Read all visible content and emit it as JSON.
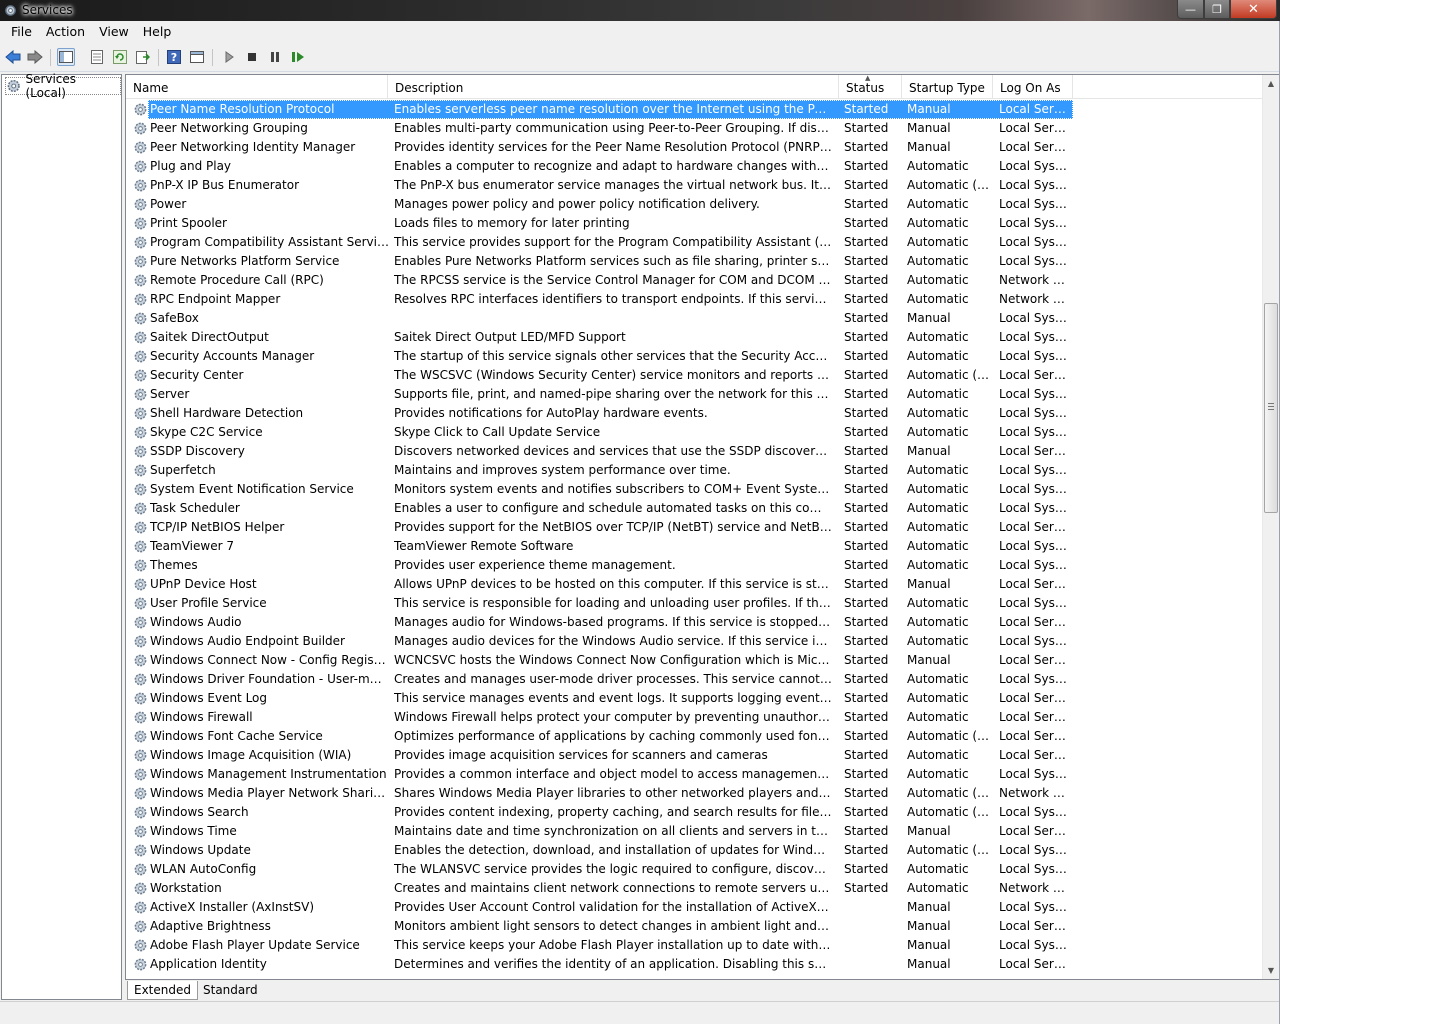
{
  "window": {
    "title": "Services",
    "minimize": "—",
    "maximize": "❐",
    "close": "✕"
  },
  "menu": [
    "File",
    "Action",
    "View",
    "Help"
  ],
  "tree": {
    "root": "Services (Local)"
  },
  "columns": {
    "name": "Name",
    "description": "Description",
    "status": "Status",
    "startup": "Startup Type",
    "logon": "Log On As"
  },
  "services": [
    {
      "name": "Peer Name Resolution Protocol",
      "desc": "Enables serverless peer name resolution over the Internet using the Peer Name Re...",
      "status": "Started",
      "startup": "Manual",
      "logon": "Local Service"
    },
    {
      "name": "Peer Networking Grouping",
      "desc": "Enables multi-party communication using Peer-to-Peer Grouping.  If disabled, so...",
      "status": "Started",
      "startup": "Manual",
      "logon": "Local Service"
    },
    {
      "name": "Peer Networking Identity Manager",
      "desc": "Provides identity services for the Peer Name Resolution Protocol (PNRP) and Peer...",
      "status": "Started",
      "startup": "Manual",
      "logon": "Local Service"
    },
    {
      "name": "Plug and Play",
      "desc": "Enables a computer to recognize and adapt to hardware changes with little or no ...",
      "status": "Started",
      "startup": "Automatic",
      "logon": "Local Syste..."
    },
    {
      "name": "PnP-X IP Bus Enumerator",
      "desc": "The PnP-X bus enumerator service manages the virtual network bus. It discovers ...",
      "status": "Started",
      "startup": "Automatic (D...",
      "logon": "Local Syste..."
    },
    {
      "name": "Power",
      "desc": "Manages power policy and power policy notification delivery.",
      "status": "Started",
      "startup": "Automatic",
      "logon": "Local Syste..."
    },
    {
      "name": "Print Spooler",
      "desc": "Loads files to memory for later printing",
      "status": "Started",
      "startup": "Automatic",
      "logon": "Local Syste..."
    },
    {
      "name": "Program Compatibility Assistant Service",
      "desc": "This service provides support for the Program Compatibility Assistant (PCA).  PC...",
      "status": "Started",
      "startup": "Automatic",
      "logon": "Local Syste..."
    },
    {
      "name": "Pure Networks Platform Service",
      "desc": "Enables Pure Networks Platform services such as file sharing, printer sharing, and ...",
      "status": "Started",
      "startup": "Automatic",
      "logon": "Local Syste..."
    },
    {
      "name": "Remote Procedure Call (RPC)",
      "desc": "The RPCSS service is the Service Control Manager for COM and DCOM servers. It ...",
      "status": "Started",
      "startup": "Automatic",
      "logon": "Network S..."
    },
    {
      "name": "RPC Endpoint Mapper",
      "desc": "Resolves RPC interfaces identifiers to transport endpoints. If this service is stoppe...",
      "status": "Started",
      "startup": "Automatic",
      "logon": "Network S..."
    },
    {
      "name": "SafeBox",
      "desc": "",
      "status": "Started",
      "startup": "Manual",
      "logon": "Local Syste..."
    },
    {
      "name": "Saitek DirectOutput",
      "desc": "Saitek Direct Output LED/MFD Support",
      "status": "Started",
      "startup": "Automatic",
      "logon": "Local Syste..."
    },
    {
      "name": "Security Accounts Manager",
      "desc": "The startup of this service signals other services that the Security Accounts Mana...",
      "status": "Started",
      "startup": "Automatic",
      "logon": "Local Syste..."
    },
    {
      "name": "Security Center",
      "desc": "The WSCSVC (Windows Security Center) service monitors and reports security he...",
      "status": "Started",
      "startup": "Automatic (D...",
      "logon": "Local Service"
    },
    {
      "name": "Server",
      "desc": "Supports file, print, and named-pipe sharing over the network for this computer. I...",
      "status": "Started",
      "startup": "Automatic",
      "logon": "Local Syste..."
    },
    {
      "name": "Shell Hardware Detection",
      "desc": "Provides notifications for AutoPlay hardware events.",
      "status": "Started",
      "startup": "Automatic",
      "logon": "Local Syste..."
    },
    {
      "name": "Skype C2C Service",
      "desc": "Skype Click to Call Update Service",
      "status": "Started",
      "startup": "Automatic",
      "logon": "Local Syste..."
    },
    {
      "name": "SSDP Discovery",
      "desc": "Discovers networked devices and services that use the SSDP discovery protocol, s...",
      "status": "Started",
      "startup": "Manual",
      "logon": "Local Service"
    },
    {
      "name": "Superfetch",
      "desc": "Maintains and improves system performance over time.",
      "status": "Started",
      "startup": "Automatic",
      "logon": "Local Syste..."
    },
    {
      "name": "System Event Notification Service",
      "desc": "Monitors system events and notifies subscribers to COM+ Event System of these ...",
      "status": "Started",
      "startup": "Automatic",
      "logon": "Local Syste..."
    },
    {
      "name": "Task Scheduler",
      "desc": "Enables a user to configure and schedule automated tasks on this computer. The ...",
      "status": "Started",
      "startup": "Automatic",
      "logon": "Local Syste..."
    },
    {
      "name": "TCP/IP NetBIOS Helper",
      "desc": "Provides support for the NetBIOS over TCP/IP (NetBT) service and NetBIOS name ...",
      "status": "Started",
      "startup": "Automatic",
      "logon": "Local Service"
    },
    {
      "name": "TeamViewer 7",
      "desc": "TeamViewer Remote Software",
      "status": "Started",
      "startup": "Automatic",
      "logon": "Local Syste..."
    },
    {
      "name": "Themes",
      "desc": "Provides user experience theme management.",
      "status": "Started",
      "startup": "Automatic",
      "logon": "Local Syste..."
    },
    {
      "name": "UPnP Device Host",
      "desc": "Allows UPnP devices to be hosted on this computer. If this service is stopped, any...",
      "status": "Started",
      "startup": "Manual",
      "logon": "Local Service"
    },
    {
      "name": "User Profile Service",
      "desc": "This service is responsible for loading and unloading user profiles. If this service is...",
      "status": "Started",
      "startup": "Automatic",
      "logon": "Local Syste..."
    },
    {
      "name": "Windows Audio",
      "desc": "Manages audio for Windows-based programs.  If this service is stopped, audio de...",
      "status": "Started",
      "startup": "Automatic",
      "logon": "Local Service"
    },
    {
      "name": "Windows Audio Endpoint Builder",
      "desc": "Manages audio devices for the Windows Audio service.  If this service is stopped, ...",
      "status": "Started",
      "startup": "Automatic",
      "logon": "Local Syste..."
    },
    {
      "name": "Windows Connect Now - Config Registrar",
      "desc": "WCNCSVC hosts the Windows Connect Now Configuration which is Microsoft's I...",
      "status": "Started",
      "startup": "Manual",
      "logon": "Local Service"
    },
    {
      "name": "Windows Driver Foundation - User-mode D...",
      "desc": "Creates and manages user-mode driver processes. This service cannot be stopped.",
      "status": "Started",
      "startup": "Automatic",
      "logon": "Local Syste..."
    },
    {
      "name": "Windows Event Log",
      "desc": "This service manages events and event logs. It supports logging events, querying ...",
      "status": "Started",
      "startup": "Automatic",
      "logon": "Local Service"
    },
    {
      "name": "Windows Firewall",
      "desc": "Windows Firewall helps protect your computer by preventing unauthorized users ...",
      "status": "Started",
      "startup": "Automatic",
      "logon": "Local Service"
    },
    {
      "name": "Windows Font Cache Service",
      "desc": "Optimizes performance of applications by caching commonly used font data. Ap...",
      "status": "Started",
      "startup": "Automatic (D...",
      "logon": "Local Service"
    },
    {
      "name": "Windows Image Acquisition (WIA)",
      "desc": "Provides image acquisition services for scanners and cameras",
      "status": "Started",
      "startup": "Automatic",
      "logon": "Local Service"
    },
    {
      "name": "Windows Management Instrumentation",
      "desc": "Provides a common interface and object model to access management informati...",
      "status": "Started",
      "startup": "Automatic",
      "logon": "Local Syste..."
    },
    {
      "name": "Windows Media Player Network Sharing Se...",
      "desc": "Shares Windows Media Player libraries to other networked players and media devi...",
      "status": "Started",
      "startup": "Automatic (D...",
      "logon": "Network S..."
    },
    {
      "name": "Windows Search",
      "desc": "Provides content indexing, property caching, and search results for files, e-mail, a...",
      "status": "Started",
      "startup": "Automatic (D...",
      "logon": "Local Syste..."
    },
    {
      "name": "Windows Time",
      "desc": "Maintains date and time synchronization on all clients and servers in the network....",
      "status": "Started",
      "startup": "Manual",
      "logon": "Local Service"
    },
    {
      "name": "Windows Update",
      "desc": "Enables the detection, download, and installation of updates for Windows and ot...",
      "status": "Started",
      "startup": "Automatic (D...",
      "logon": "Local Syste..."
    },
    {
      "name": "WLAN AutoConfig",
      "desc": "The WLANSVC service provides the logic required to configure, discover, connect...",
      "status": "Started",
      "startup": "Automatic",
      "logon": "Local Syste..."
    },
    {
      "name": "Workstation",
      "desc": "Creates and maintains client network connections to remote servers using the SM...",
      "status": "Started",
      "startup": "Automatic",
      "logon": "Network S..."
    },
    {
      "name": "ActiveX Installer (AxInstSV)",
      "desc": "Provides User Account Control validation for the installation of ActiveX controls f...",
      "status": "",
      "startup": "Manual",
      "logon": "Local Syste..."
    },
    {
      "name": "Adaptive Brightness",
      "desc": "Monitors ambient light sensors to detect changes in ambient light and adjust the ...",
      "status": "",
      "startup": "Manual",
      "logon": "Local Service"
    },
    {
      "name": "Adobe Flash Player Update Service",
      "desc": "This service keeps your Adobe Flash Player installation up to date with the latest e...",
      "status": "",
      "startup": "Manual",
      "logon": "Local Syste..."
    },
    {
      "name": "Application Identity",
      "desc": "Determines and verifies the identity of an application. Disabling this service will pr...",
      "status": "",
      "startup": "Manual",
      "logon": "Local Service"
    }
  ],
  "tabs": [
    "Extended",
    "Standard"
  ]
}
